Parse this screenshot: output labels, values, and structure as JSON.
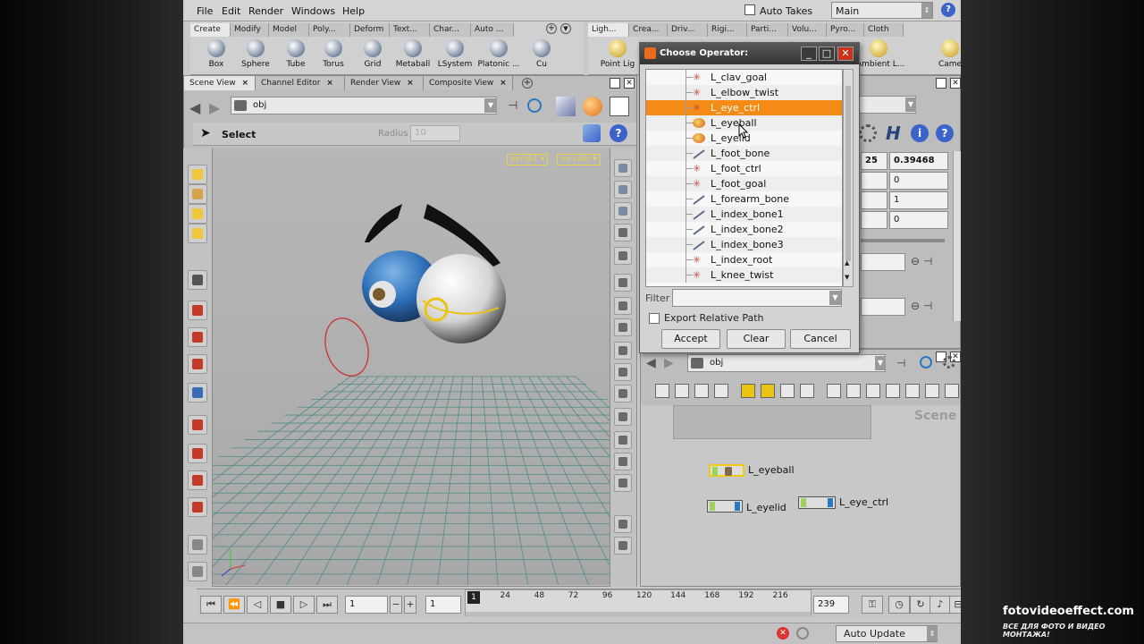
{
  "menu": {
    "file": "File",
    "edit": "Edit",
    "render": "Render",
    "windows": "Windows",
    "help": "Help"
  },
  "top": {
    "auto_takes": "Auto Takes",
    "desktop": "Main"
  },
  "shelf_left": {
    "tabs": [
      "Create",
      "Modify",
      "Model",
      "Poly...",
      "Deform",
      "Text...",
      "Char...",
      "Auto ..."
    ],
    "tools": [
      "Box",
      "Sphere",
      "Tube",
      "Torus",
      "Grid",
      "Metaball",
      "LSystem",
      "Platonic ...",
      "Cu"
    ]
  },
  "shelf_right": {
    "tabs": [
      "Ligh...",
      "Crea...",
      "Driv...",
      "Rigi...",
      "Parti...",
      "Volu...",
      "Pyro...",
      "Cloth"
    ],
    "tools": [
      "Point Lig",
      "Ambient L...",
      "Came"
    ]
  },
  "scene_panel": {
    "tabs": [
      "Scene View",
      "Channel Editor",
      "Render View",
      "Composite View"
    ],
    "path": "obj",
    "select_label": "Select",
    "radius_label": "Radius",
    "radius_value": "10",
    "camera": "persp1",
    "cam_mode": "no cam"
  },
  "params": {
    "val_a": "25",
    "val_b": "0.39468",
    "val_c": "0",
    "val_d": "1",
    "val_e": "0"
  },
  "network": {
    "path": "obj",
    "watermark": "Scene",
    "nodes": [
      "L_eyeball",
      "L_eyelid",
      "L_eye_ctrl"
    ]
  },
  "timeline": {
    "frame": "1",
    "start": "1",
    "end": "239",
    "ticks": [
      "24",
      "48",
      "72",
      "96",
      "120",
      "144",
      "168",
      "192",
      "216"
    ],
    "marker": "1"
  },
  "status": {
    "auto_update": "Auto Update"
  },
  "dialog": {
    "title": "Choose Operator:",
    "items": [
      "L_clav_goal",
      "L_elbow_twist",
      "L_eye_ctrl",
      "L_eyeball",
      "L_eyelid",
      "L_foot_bone",
      "L_foot_ctrl",
      "L_foot_goal",
      "L_forearm_bone",
      "L_index_bone1",
      "L_index_bone2",
      "L_index_bone3",
      "L_index_root",
      "L_knee_twist"
    ],
    "selected_index": 2,
    "filter_label": "Filter",
    "filter_value": "",
    "export_relative": "Export Relative Path",
    "accept": "Accept",
    "clear": "Clear",
    "cancel": "Cancel"
  },
  "branding": {
    "site": "fotovideoeffect.com",
    "tagline": "ВСЕ ДЛЯ ФОТО И ВИДЕО МОНТАЖА!"
  },
  "colors": {
    "selection": "#f38b16",
    "accent_yellow": "#e8d24a",
    "grid": "#4f8c8a"
  }
}
